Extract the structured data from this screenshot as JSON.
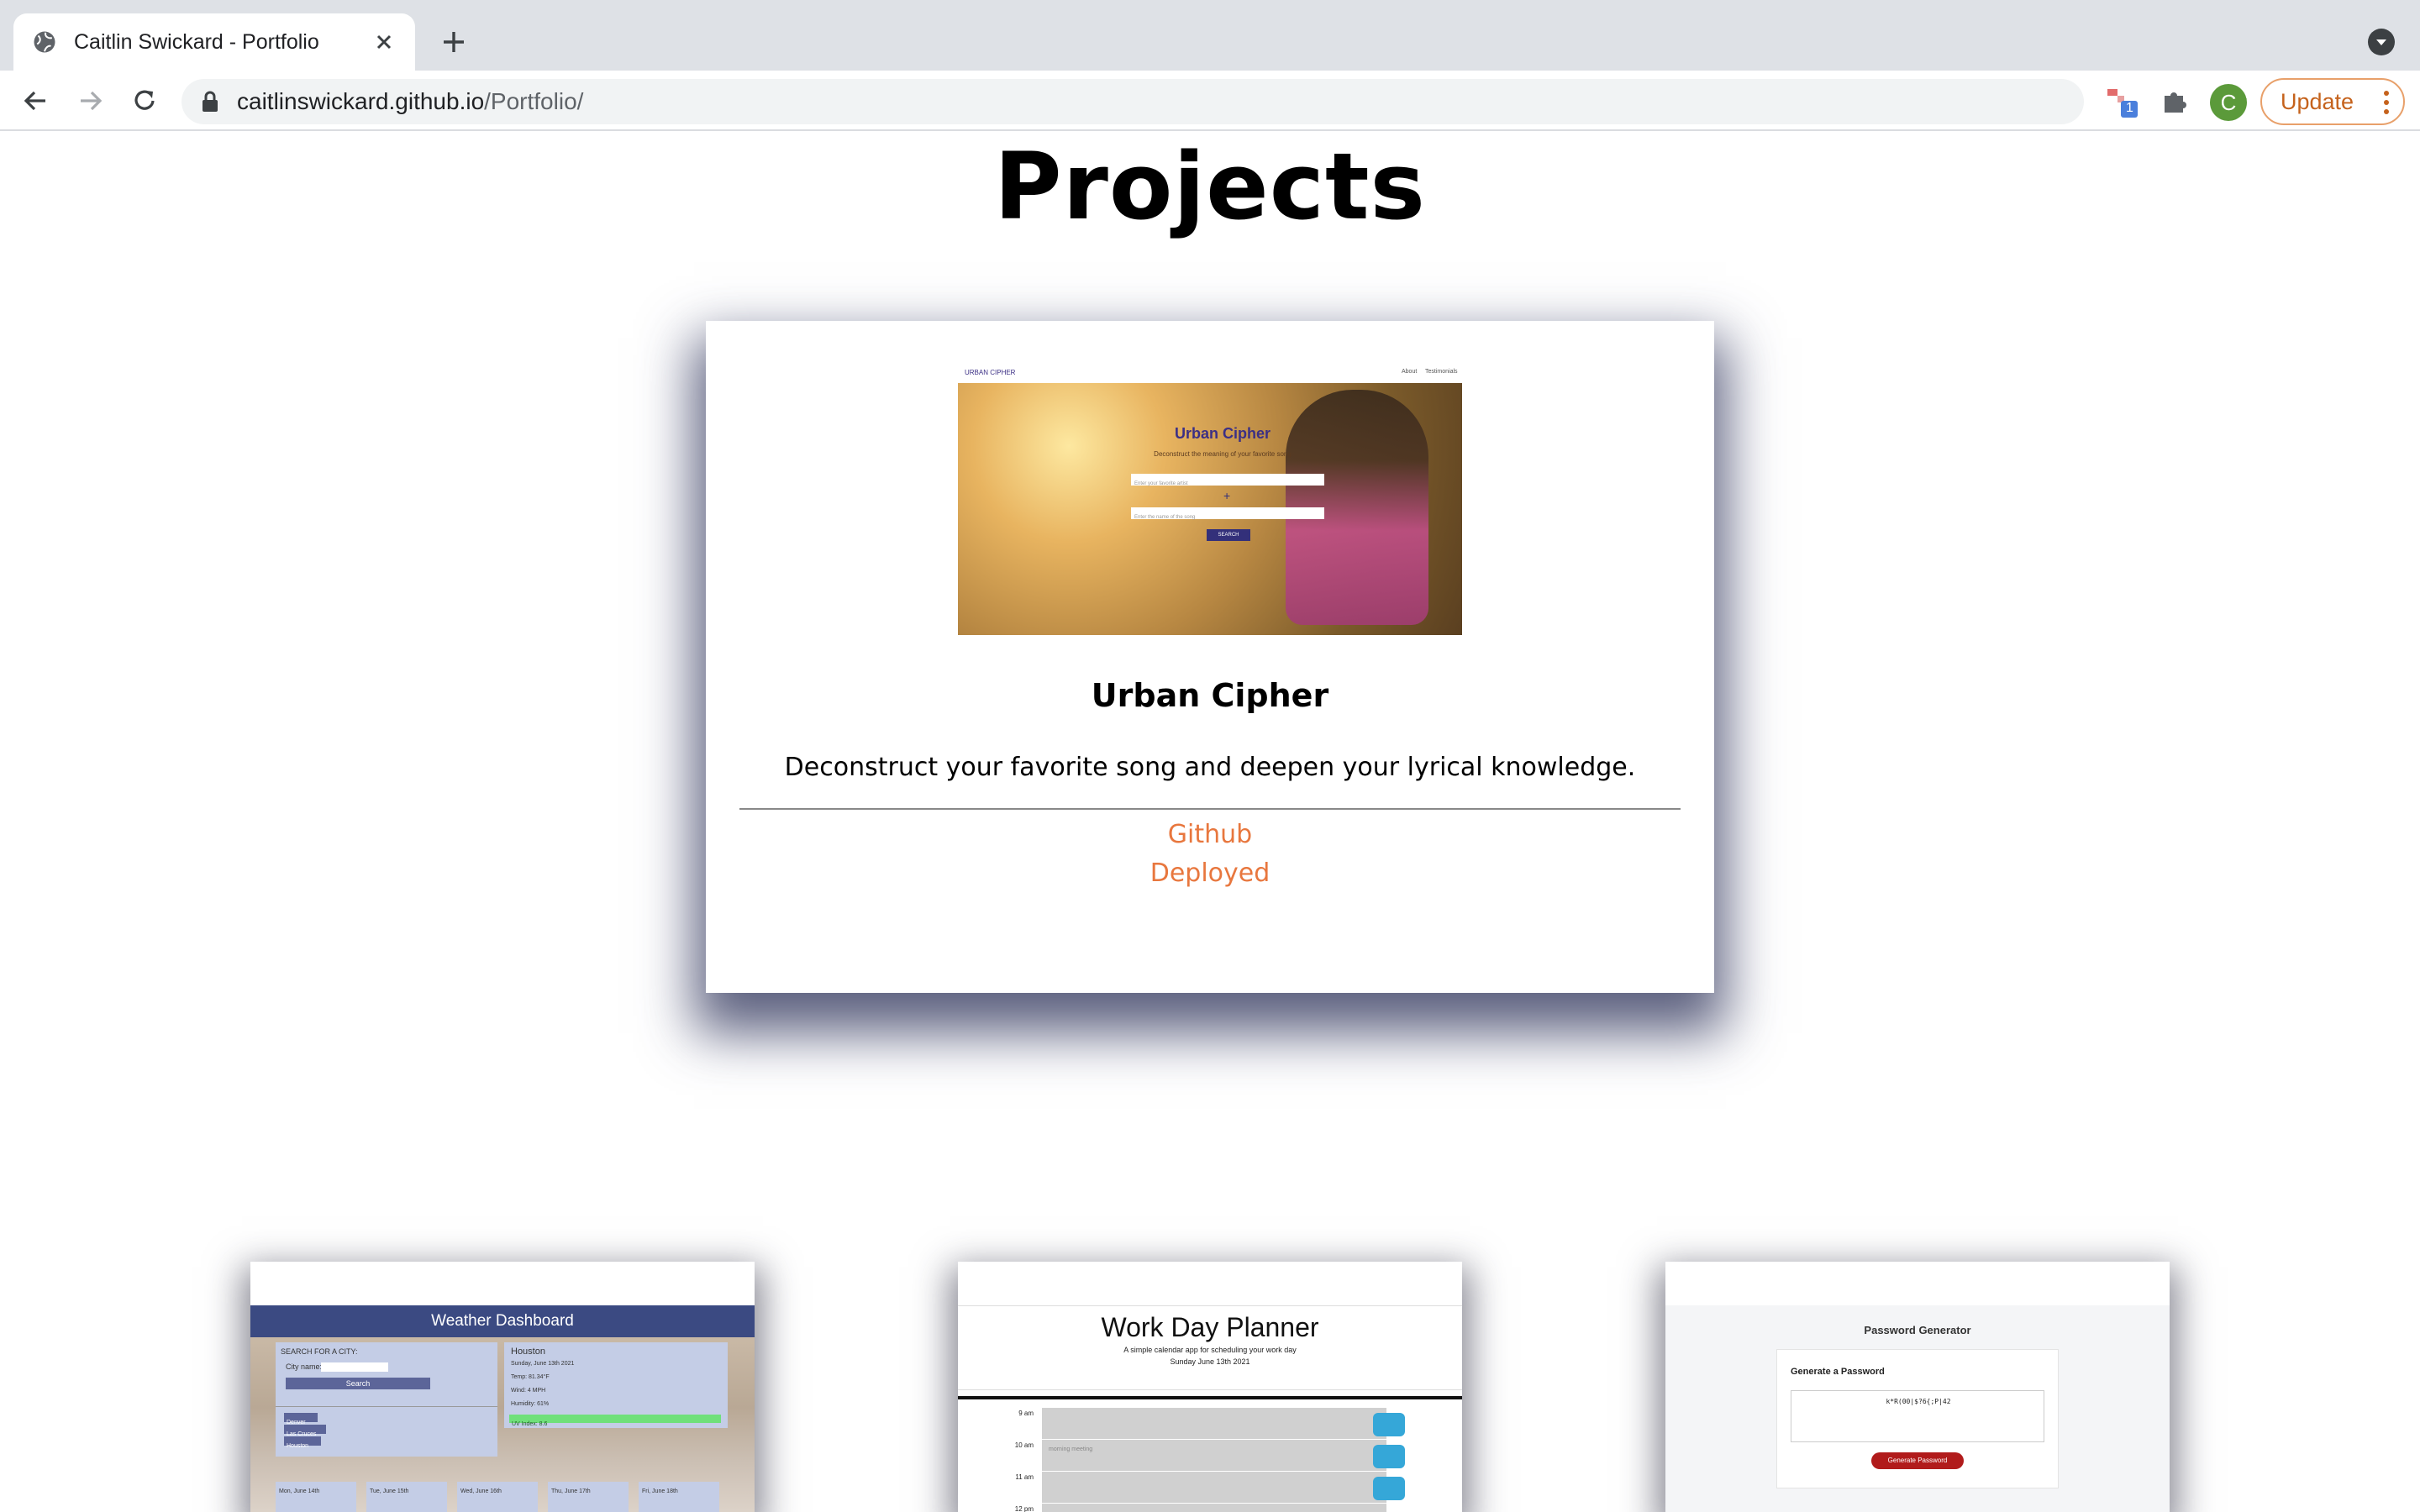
{
  "browser": {
    "tab_title": "Caitlin Swickard - Portfolio",
    "url_host": "caitlinswickard.github.io",
    "url_path": "/Portfolio/",
    "avatar_letter": "C",
    "update_label": "Update",
    "extension_badge": "1",
    "icons": [
      "globe-icon",
      "close-icon",
      "plus-icon",
      "back-icon",
      "forward-icon",
      "reload-icon",
      "lock-icon",
      "star-icon",
      "puzzle-icon",
      "more-icon"
    ]
  },
  "page": {
    "heading": "Projects",
    "featured": {
      "title": "Urban Cipher",
      "description": "Deconstruct your favorite song and deepen your lyrical knowledge.",
      "links": [
        "Github",
        "Deployed"
      ],
      "screenshot": {
        "nav_brand": "URBAN CIPHER",
        "nav_links": [
          "About",
          "Testimonials"
        ],
        "title": "Urban Cipher",
        "subtitle": "Deconstruct the meaning of your favorite song",
        "artist_placeholder": "Enter your favorite artist",
        "song_placeholder": "Enter the name of the song",
        "button": "SEARCH"
      }
    },
    "projects": [
      {
        "name": "Weather Dashboard",
        "search_label": "SEARCH FOR A CITY:",
        "city_label": "City name:",
        "search_button": "Search",
        "city": "Houston",
        "date": "Sunday, June 13th 2021",
        "stats": [
          "Temp: 81.34°F",
          "Wind: 4 MPH",
          "Humidity: 61%",
          "UV Index: 8.6"
        ],
        "history": [
          "Denver",
          "Las Cruces",
          "Houston"
        ],
        "forecast": [
          "Mon, June 14th",
          "Tue, June 15th",
          "Wed, June 16th",
          "Thu, June 17th",
          "Fri, June 18th"
        ]
      },
      {
        "name": "Work Day Planner",
        "tagline": "A simple calendar app for scheduling your work day",
        "date": "Sunday June 13th 2021",
        "hours": [
          "9 am",
          "10 am",
          "11 am",
          "12 pm"
        ],
        "entry": "morning meeting"
      },
      {
        "name": "Password Generator",
        "card_label": "Generate a Password",
        "password": "k*R(00|$?6{;P|42",
        "button": "Generate Password"
      }
    ]
  }
}
